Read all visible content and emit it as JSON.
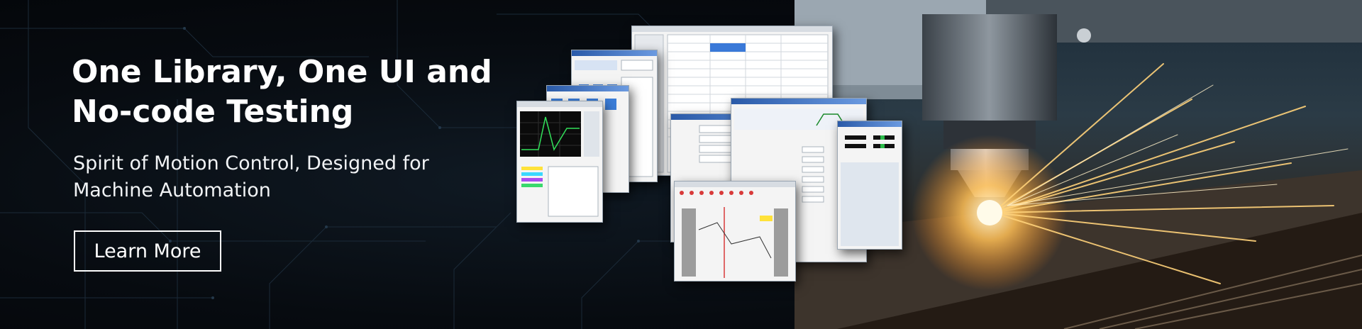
{
  "hero": {
    "headline": "One Library, One UI and No-code Testing",
    "subline": "Spirit of Motion Control, Designed for Machine Automation",
    "cta_label": "Learn More"
  },
  "colors": {
    "background": "#05080c",
    "text": "#ffffff",
    "accent_spark": "#ffb347",
    "window_titlebar": "#2a5aa8"
  }
}
